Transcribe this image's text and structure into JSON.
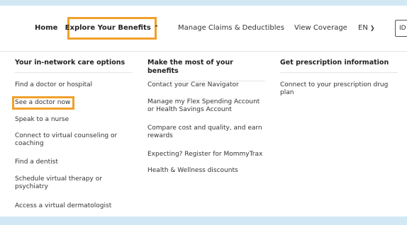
{
  "nav": {
    "home": "Home",
    "explore": "Explore Your Benefits",
    "explore_chevron": "^",
    "claims": "Manage Claims & Deductibles",
    "coverage": "View Coverage",
    "lang": "EN",
    "lang_chevron": "v",
    "id_label": "ID"
  },
  "menu": {
    "col1": {
      "heading": "Your in-network care options",
      "items": [
        "Find a doctor or hospital",
        "See a doctor now",
        "Speak to a nurse",
        "Connect to virtual counseling or coaching",
        "Find a dentist",
        "Schedule virtual therapy or psychiatry",
        "Access a virtual dermatologist"
      ]
    },
    "col2": {
      "heading": "Make the most of your benefits",
      "items": [
        "Contact your Care Navigator",
        "Manage my Flex Spending Account or Health Savings Account",
        "Compare cost and quality, and earn rewards",
        "Expecting? Register for MommyTrax",
        "Health & Wellness discounts"
      ]
    },
    "col3": {
      "heading": "Get prescription information",
      "items": [
        "Connect to your prescription drug plan"
      ]
    }
  },
  "highlight_color": "#f1a02b",
  "background_color": "#d2e8f5"
}
